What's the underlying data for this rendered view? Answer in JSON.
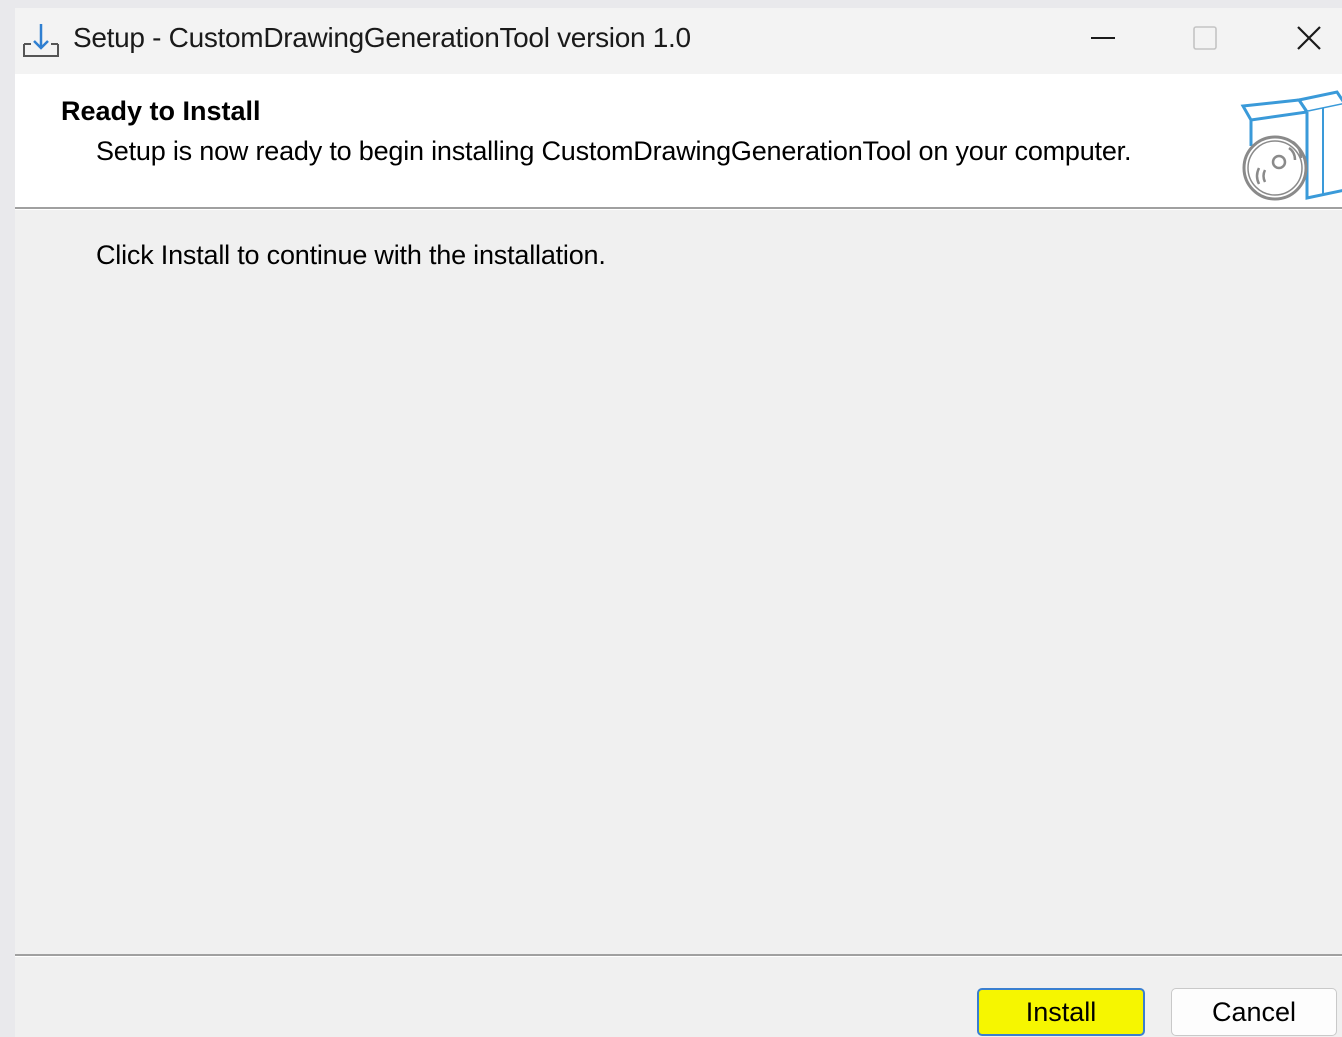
{
  "window": {
    "title": "Setup - CustomDrawingGenerationTool version 1.0",
    "icons": {
      "app": "setup-download-icon",
      "minimize": "minimize-icon",
      "maximize": "maximize-icon",
      "close": "close-icon",
      "header_graphic": "software-box-disc-icon"
    }
  },
  "header": {
    "title": "Ready to Install",
    "subtitle": "Setup is now ready to begin installing CustomDrawingGenerationTool on your computer."
  },
  "body": {
    "message": "Click Install to continue with the installation."
  },
  "buttons": {
    "install_label": "Install",
    "cancel_label": "Cancel"
  },
  "colors": {
    "highlight": "#f6f600",
    "focus_border": "#3a7fd0",
    "graphic_blue": "#3a9ad9"
  }
}
